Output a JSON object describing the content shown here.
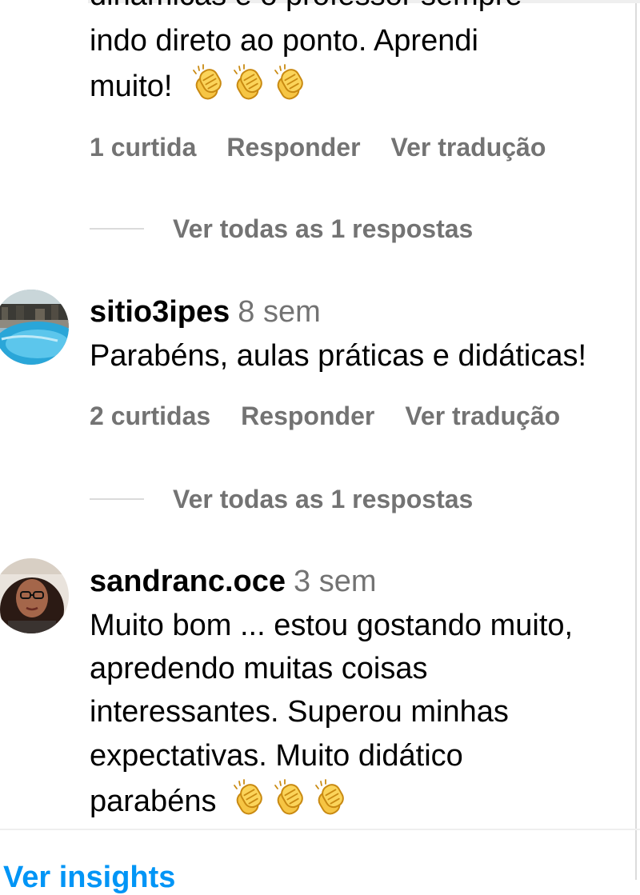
{
  "comment1": {
    "text_clipped": "dinâmicas e o professor sempre",
    "text_line1": "indo direto ao ponto. Aprendi",
    "text_line2": "muito!",
    "emoji": "clapping-hands-emoji",
    "likes": "1 curtida",
    "reply_label": "Responder",
    "translate_label": "Ver tradução",
    "view_replies": "Ver todas as 1 respostas"
  },
  "comment2": {
    "username": "sitio3ipes",
    "time": "8 sem",
    "text": "Parabéns, aulas práticas e didáticas!",
    "likes": "2 curtidas",
    "reply_label": "Responder",
    "translate_label": "Ver tradução",
    "view_replies": "Ver todas as 1 respostas",
    "avatar": "pool-avatar"
  },
  "comment3": {
    "username": "sandranc.oce",
    "time": "3 sem",
    "text_line1": "Muito bom ... estou gostando muito,",
    "text_line2": "apredendo muitas coisas",
    "text_line3": "interessantes. Superou minhas",
    "text_line4": "expectativas. Muito didático",
    "text_line5": "parabéns",
    "emoji": "clapping-hands-emoji",
    "avatar": "woman-avatar"
  },
  "footer": {
    "insights_link": "Ver insights"
  },
  "colors": {
    "secondary_text": "#737373",
    "link_blue": "#0095f6",
    "divider": "#dbdbdb",
    "emoji_yellow": "#f5c518"
  }
}
